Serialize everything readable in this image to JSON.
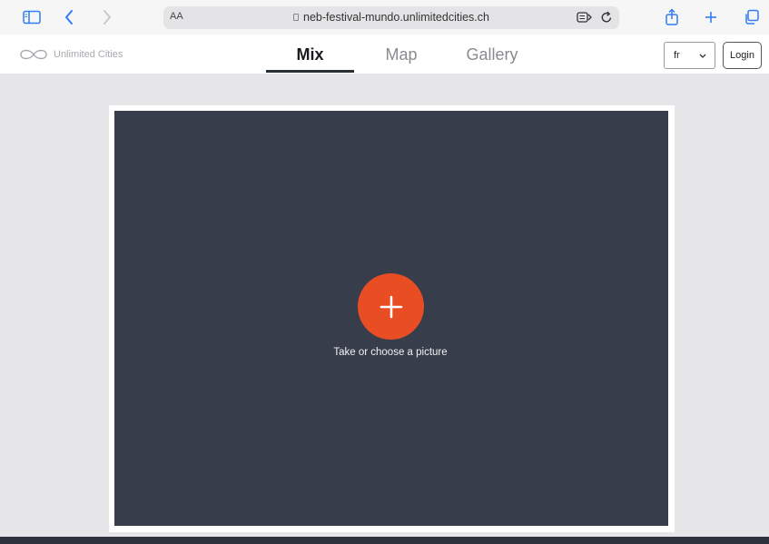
{
  "browser": {
    "text_size_label": "AA",
    "url": "neb-festival-mundo.unlimitedcities.ch",
    "accent_color": "#2f7cf6"
  },
  "site": {
    "brand_name": "Unlimited Cities",
    "tabs": [
      {
        "label": "Mix",
        "active": true
      },
      {
        "label": "Map",
        "active": false
      },
      {
        "label": "Gallery",
        "active": false
      }
    ],
    "language_selected": "fr",
    "login_label": "Login"
  },
  "main": {
    "add_picture_caption": "Take or choose a picture",
    "canvas_color": "#383d4b",
    "add_button_color": "#e84d24"
  }
}
